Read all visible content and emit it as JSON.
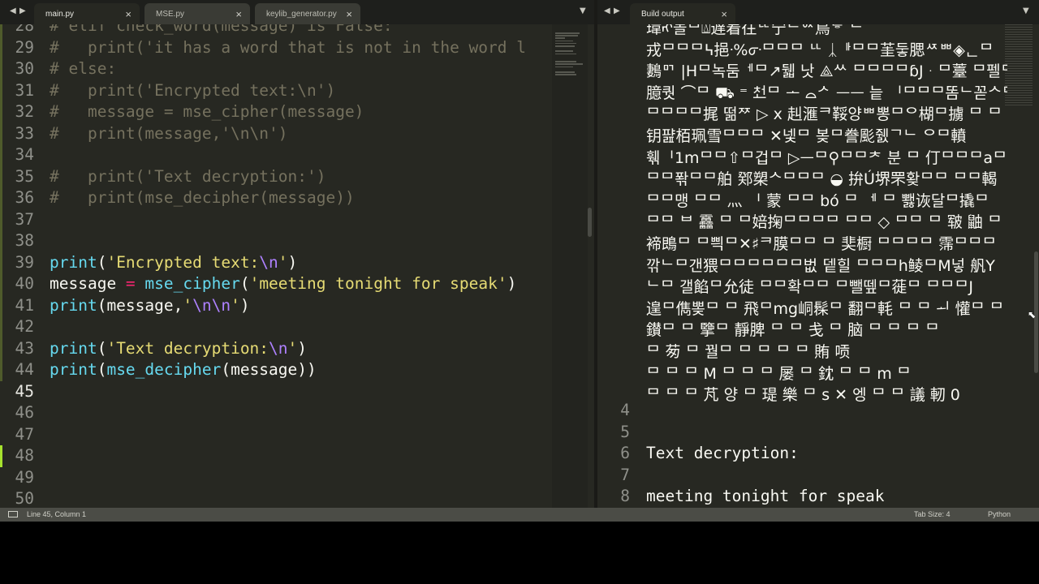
{
  "tabs_left": [
    {
      "label": "main.py",
      "active": true
    },
    {
      "label": "MSE.py",
      "active": false
    },
    {
      "label": "keylib_generator.py",
      "active": false
    }
  ],
  "tab_right": {
    "label": "Build output"
  },
  "close_glyph": "×",
  "nav_left_glyph": "◀",
  "nav_right_glyph": "▶",
  "dropdown_glyph": "▼",
  "editor_lines": [
    {
      "num": "28",
      "tokens": [
        {
          "t": "# elif check_word(message) is False:",
          "c": "cm"
        }
      ]
    },
    {
      "num": "29",
      "tokens": [
        {
          "t": "#   print('it has a word that is not in the word l",
          "c": "cm"
        }
      ]
    },
    {
      "num": "30",
      "tokens": [
        {
          "t": "# else:",
          "c": "cm"
        }
      ]
    },
    {
      "num": "31",
      "tokens": [
        {
          "t": "#   print('Encrypted text:\\n')",
          "c": "cm"
        }
      ]
    },
    {
      "num": "32",
      "tokens": [
        {
          "t": "#   message = mse_cipher(message)",
          "c": "cm"
        }
      ]
    },
    {
      "num": "33",
      "tokens": [
        {
          "t": "#   print(message,'\\n\\n')",
          "c": "cm"
        }
      ]
    },
    {
      "num": "34",
      "tokens": []
    },
    {
      "num": "35",
      "tokens": [
        {
          "t": "#   print('Text decryption:')",
          "c": "cm"
        }
      ]
    },
    {
      "num": "36",
      "tokens": [
        {
          "t": "#   print(mse_decipher(message))",
          "c": "cm"
        }
      ]
    },
    {
      "num": "37",
      "tokens": []
    },
    {
      "num": "38",
      "tokens": []
    },
    {
      "num": "39",
      "tokens": [
        {
          "t": "print",
          "c": "fn"
        },
        {
          "t": "(",
          "c": ""
        },
        {
          "t": "'Encrypted text:",
          "c": "str"
        },
        {
          "t": "\\n",
          "c": "esc"
        },
        {
          "t": "'",
          "c": "str"
        },
        {
          "t": ")",
          "c": ""
        }
      ]
    },
    {
      "num": "40",
      "tokens": [
        {
          "t": "message ",
          "c": ""
        },
        {
          "t": "=",
          "c": "op"
        },
        {
          "t": " ",
          "c": ""
        },
        {
          "t": "mse_cipher",
          "c": "fn"
        },
        {
          "t": "(",
          "c": ""
        },
        {
          "t": "'meeting tonight for speak'",
          "c": "str"
        },
        {
          "t": ")",
          "c": ""
        }
      ]
    },
    {
      "num": "41",
      "tokens": [
        {
          "t": "print",
          "c": "fn"
        },
        {
          "t": "(message,",
          "c": ""
        },
        {
          "t": "'",
          "c": "str"
        },
        {
          "t": "\\n\\n",
          "c": "esc"
        },
        {
          "t": "'",
          "c": "str"
        },
        {
          "t": ")",
          "c": ""
        }
      ]
    },
    {
      "num": "42",
      "tokens": []
    },
    {
      "num": "43",
      "tokens": [
        {
          "t": "print",
          "c": "fn"
        },
        {
          "t": "(",
          "c": ""
        },
        {
          "t": "'Text decryption:",
          "c": "str"
        },
        {
          "t": "\\n",
          "c": "esc"
        },
        {
          "t": "'",
          "c": "str"
        },
        {
          "t": ")",
          "c": ""
        }
      ]
    },
    {
      "num": "44",
      "tokens": [
        {
          "t": "print",
          "c": "fn"
        },
        {
          "t": "(",
          "c": ""
        },
        {
          "t": "mse_decipher",
          "c": "fn"
        },
        {
          "t": "(message))",
          "c": ""
        }
      ]
    },
    {
      "num": "45",
      "tokens": [],
      "current": true
    },
    {
      "num": "46",
      "tokens": []
    },
    {
      "num": "47",
      "tokens": []
    },
    {
      "num": "48",
      "tokens": [],
      "modified": true
    },
    {
      "num": "49",
      "tokens": []
    },
    {
      "num": "50",
      "tokens": []
    }
  ],
  "output_garbled": [
    "瑋ᡊ놀ᄆ⍍遅着往ᄕ宁ᄃᅈ鳥ᄛ ᄃ",
    "戎ᄆᄆᄆ߆挹ᐧ%ᣇᄆᄆᄆ ᄔ ᛣᆘᄆᄆ茥둫腮ᄶᄈ◈ᆫᄆ",
    "鶈ᄆᄀ |Hᄆ녹둠ᅦᄆ↗뒓 낫   ⟁ᄊ ᄆᄆᄆᄆɓJᆞᄆ薹 ᄆ펠ᄆ",
    "臆퀏 ⌒ᄆ ⛟ ⁼ ᅔᅺᄆ ᅩ ⌓ᄼ ᅳᅳ 늩 ᅵᄆᄆᄆ똠ᄂ꼳ᄉᄆᄋ",
    "ᄆᄆᄆᄆ捤 떪ᅏ ▷ x 赳滙ᄏ鞖양ᄈ뽕ᄆᄋ楜ᄆ擄 ᄆ ᄆ",
    "钥퍒栢珮雪ᄆᄆᄆ ✕넻ᄆ 봊ᄆ誊颩쥀ᄀᄂ  ᄋᄆ轒",
    "훾ᅵ1mᄆᄆ⇧ᄆ겁ᄆ ▷ᅳᄆ⚲ᄆᄆᅔ 분 ᄆ 仃ᄆᄆᄆaᄆᄆᄆᄆ뾂ᄃ",
    "ᄆᄆ퐊ᄆᄆ舶 鄈槊ᄉᄆᄆᄆ ◒ 拚Ú堺罘홪ᄆᄆ ᄆᄆ輵",
    "ᄆᄆ맹 ᄆᄆ 灬 ᅵ 蒙 ᄆᄆ bó ᄆ ᅦ ᄆ 뾇诙달ᄆ撬ᄆ",
    "ᄆᄆ ᄇ 靐 ᄆ ᄆ婄掬ᄆᄆᄆᄆ ᄆᄆ ◇ ᄆᄆ ᄆ 皲 鼬  ᄆ",
    "褅鵖ᄆ ᄆ쁵ᄆ✕♯ᄏ膜ᄆᄆ ᄆ 奜橱 ᄆᄆᄆᄆ 霈ᄆᄆᄆ",
    "깎ᄂᄆ갠猥ᄆᄆᄆᄆᄆᄆ벖 뎉힐 ᄆᄆᄆh鲮ᄆM넣 舤Y",
    "ᄂᄆ 갤餡ᄆ允徒 ᄆᄆ확ᄆᄆ ᄆ뺄뗖ᄆ蓰ᄆ ᄆᄆᄆJ",
    "遑ᄆ儁뽖ᄆ ᄆ 飛ᄆmg峒髹ᄆ 翻ᄆ軞 ᄆ ᄆ ᅬ 懽ᄆ ᄆ",
    "鑚ᄆ ᄆ 擥ᄆ 靜脾 ᄆ ᄆ 戋 ᄆ 脑 ᄆ ᄆ ᄆ ᄆ",
    "  ᄆ 茐 ᄆ 꿜ᄆ ᄆ ᄆ ᄆ ᄆ 賄 唝",
    " ᄆ ᄆ ᄆ M ᄆ ᄆ ᄆ 屡 ᄆ 鈂 ᄆ ᄆ m ᄆ",
    "ᄆ ᄆ ᄆ 芃 양 ᄆ 瑅 樂 ᄆ s ✕ 엥 ᄆ ᄆ 議 軔 0"
  ],
  "output_lines": [
    {
      "num": "4",
      "text": ""
    },
    {
      "num": "5",
      "text": ""
    },
    {
      "num": "6",
      "text": "Text decryption:"
    },
    {
      "num": "7",
      "text": ""
    },
    {
      "num": "8",
      "text": "meeting tonight for speak"
    }
  ],
  "status": {
    "position": "Line 45, Column 1",
    "tab_size": "Tab Size: 4",
    "syntax": "Python"
  },
  "colors": {
    "background": "#272822",
    "comment": "#75715e",
    "function": "#66d9ef",
    "string": "#e6db74",
    "escape": "#ae81ff",
    "operator": "#f92672",
    "modified_marker": "#a6e22e"
  }
}
